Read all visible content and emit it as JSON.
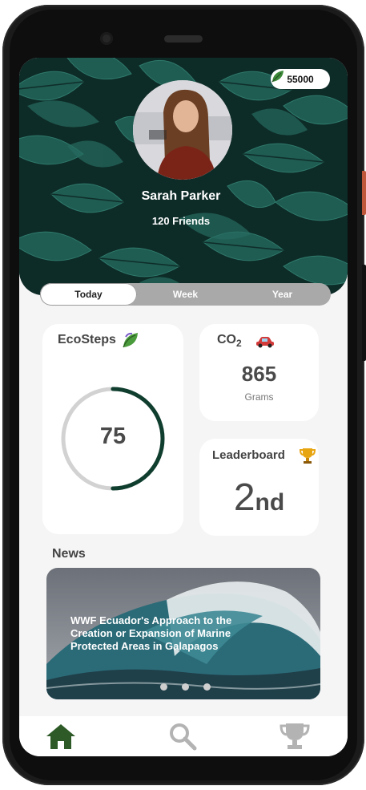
{
  "header": {
    "coins": "55000",
    "user_name": "Sarah Parker",
    "friends": "120 Friends"
  },
  "tabs": [
    {
      "label": "Today",
      "active": true
    },
    {
      "label": "Week",
      "active": false
    },
    {
      "label": "Year",
      "active": false
    }
  ],
  "ecosteps": {
    "title": "EcoSteps",
    "value": "75",
    "progress": 0.5
  },
  "co2": {
    "title_main": "CO",
    "title_sub": "2",
    "value": "865",
    "unit": "Grams"
  },
  "leaderboard": {
    "title": "Leaderboard",
    "rank_number": "2",
    "rank_suffix": "nd"
  },
  "news": {
    "section_title": "News",
    "headline": "WWF Ecuador's Approach to the Creation or Expansion of Marine Protected Areas in Galapagos",
    "dots": 3
  },
  "nav": [
    {
      "icon": "home-icon",
      "active": true
    },
    {
      "icon": "search-icon",
      "active": false
    },
    {
      "icon": "trophy-icon",
      "active": false
    }
  ],
  "colors": {
    "accent_green": "#0f3d2e",
    "nav_active": "#2d5a27",
    "nav_inactive": "#b3b3b3"
  }
}
